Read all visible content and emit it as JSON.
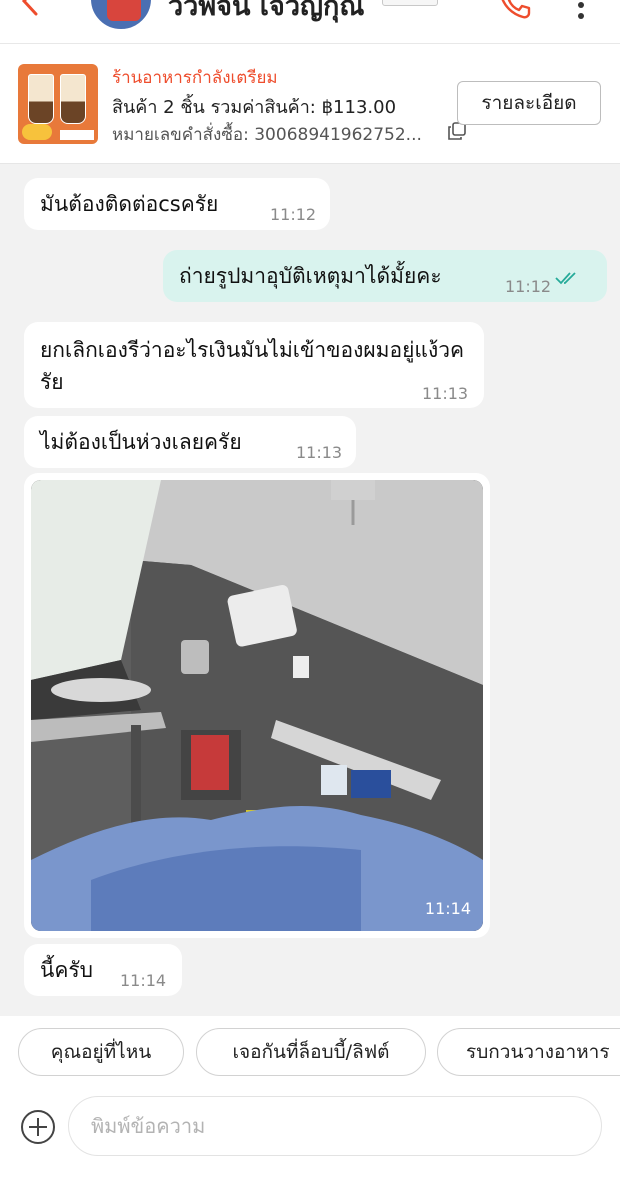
{
  "header": {
    "contact_name": "ววพจน เจวญกุณ",
    "back_icon": "back-arrow-icon",
    "phone_icon": "phone-icon",
    "more_icon": "more-vertical-icon",
    "accent_color": "#ee4d2d"
  },
  "order": {
    "status": "ร้านอาหารกำลังเตรียม",
    "summary": "สินค้า 2 ชิ้น รวมค่าสินค้า: ฿113.00",
    "order_number": "หมายเลขคำสั่งซื้อ: 30068941962752...",
    "details_label": "รายละเอียด",
    "copy_icon": "copy-icon"
  },
  "messages": [
    {
      "side": "incoming",
      "text": "มันต้องติดต่อcsครัย",
      "time": "11:12"
    },
    {
      "side": "outgoing",
      "text": "ถ่ายรูปมาอุบัติเหตุมาได้มั้ยคะ",
      "time": "11:12",
      "status_icon": "double-check-icon"
    },
    {
      "side": "incoming",
      "text": "ยกเลิกเองรีว่าอะไรเงินมันไม่เข้าของผมอยู่แง้วครัย",
      "time": "11:13"
    },
    {
      "side": "incoming",
      "text": "ไม่ต้องเป็นห่วงเลยครัย",
      "time": "11:13"
    },
    {
      "side": "incoming",
      "type": "image",
      "time": "11:14"
    },
    {
      "side": "incoming",
      "text": "นี้ครับ",
      "time": "11:14"
    }
  ],
  "quick_replies": [
    "คุณอยู่ที่ไหน",
    "เจอกันที่ล็อบบี้/ลิฟต์",
    "รบกวนวางอาหาร"
  ],
  "input": {
    "placeholder": "พิมพ์ข้อความ",
    "plus_icon": "plus-circle-icon"
  }
}
